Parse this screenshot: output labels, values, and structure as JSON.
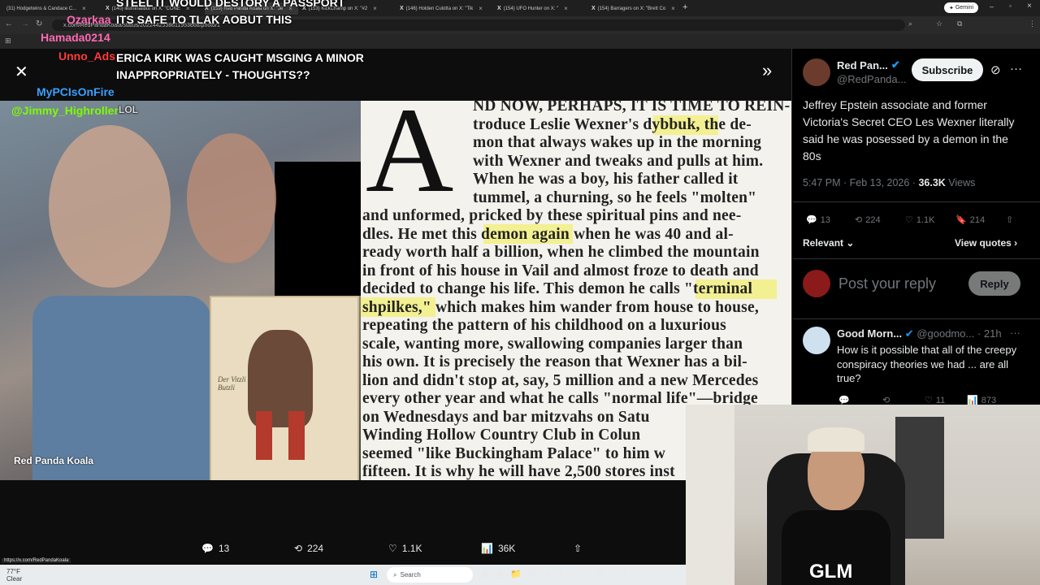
{
  "browser": {
    "tabs": [
      {
        "title": "(31) Hodgetwins & Candace C...",
        "x": 0
      },
      {
        "title": "(140) illuminatibot on X: \"CONE",
        "x": 0
      },
      {
        "title": "(159) Red Panda Koala on X: \"Je",
        "x": 0
      },
      {
        "title": "(153) KickChamp on X: \"#2 ",
        "x": 0
      },
      {
        "title": "(146) Holden Culotta on X: \"Tik",
        "x": 0
      },
      {
        "title": "(154) UFO Hunter on X: \"",
        "x": 0
      },
      {
        "title": "(154) Barragers on X: \"Brett Co",
        "x": 0
      }
    ],
    "url": "x.com/RedPandaKoala/status/2022442538611953868/photo/1",
    "gemini_label": "Gemini"
  },
  "chat": [
    {
      "name": "",
      "message": "STEEL IT WOULD DESTORY A PASSPORT",
      "color": "#ffffff"
    },
    {
      "name": "Ozarkaa",
      "message": "ITS SAFE TO TLAK AOBUT THIS",
      "color": "#ff69b4"
    },
    {
      "name": "Hamada0214",
      "message": "",
      "color": "#ff69b4"
    },
    {
      "name": "Unno_Ads",
      "message": "ERICA KIRK WAS CAUGHT MSGING A MINOR INAPPROPRIATELY - THOUGHTS??",
      "color": "#ff3b3b"
    },
    {
      "name": "MyPCIsOnFire",
      "message": "",
      "color": "#3aa0ff"
    },
    {
      "name": "@Jimmy_Highroller",
      "message": "LOL",
      "color": "#7cfc00"
    }
  ],
  "viewer": {
    "photo_credit": "Red Panda Koala",
    "demon_caption": "Der Vitzli Butzli",
    "doc_lines": [
      "ND NOW, PERHAPS, IT IS TIME TO REIN-",
      "troduce Leslie Wexner's dybbuk, the de-",
      "mon that always wakes up in the morning",
      "with Wexner and tweaks and pulls at him.",
      "When he was a boy, his father called it",
      "tummel, a churning, so he feels \"molten\"",
      "and unformed, pricked by these spiritual pins and nee-",
      "dles. He met this demon again when he was 40 and al-",
      "ready worth half a billion, when he climbed the mountain",
      "in front of his house in Vail and almost froze to death and",
      "decided to change his life. This demon he calls \"terminal",
      "shpilkes,\" which makes him wander from house to house,",
      "repeating the pattern of his childhood on a luxurious",
      "scale, wanting more, swallowing companies larger than",
      "his own. It is precisely the reason that Wexner has a bil-",
      "lion and didn't stop at, say, 5 million and a new Mercedes",
      "every other year and what he calls \"normal life\"—bridge",
      "on Wednesdays and bar mitzvahs on Satu",
      "Winding Hollow Country Club in Colun",
      "seemed \"like Buckingham Palace\" to him w",
      "fifteen. It is why he will have 2,500 stores inst"
    ],
    "dropcap": "A",
    "stats": {
      "replies": "13",
      "reposts": "224",
      "likes": "1.1K",
      "views": "36K"
    }
  },
  "tweet": {
    "author_name": "Red Pan...",
    "author_handle": "@RedPanda...",
    "subscribe_label": "Subscribe",
    "text": "Jeffrey Epstein associate and former Victoria's Secret CEO Les Wexner literally said he was posessed by a demon in the 80s",
    "time": "5:47 PM · Feb 13, 2026 ·",
    "views_count": "36.3K",
    "views_label": "Views",
    "replies": "13",
    "reposts": "224",
    "likes": "1.1K",
    "bookmarks": "214",
    "relevant_label": "Relevant",
    "view_quotes_label": "View quotes",
    "reply_placeholder": "Post your reply",
    "reply_button": "Reply"
  },
  "reply": {
    "author_name": "Good Morn...",
    "author_handle": "@goodmo...",
    "time": "· 21h",
    "text": "How is it possible that all of the creepy conspiracy theories we had ... are all true?",
    "likes": "11",
    "views": "873"
  },
  "webcam": {
    "shirt_text": "GLM"
  },
  "taskbar": {
    "weather_temp": "77°F",
    "weather_desc": "Clear",
    "search_label": "Search",
    "status_url": "https://x.com/RedPandaKoala"
  },
  "colors": {
    "accent_blue": "#1d9bf0",
    "highlight": "#f3ef7a"
  }
}
